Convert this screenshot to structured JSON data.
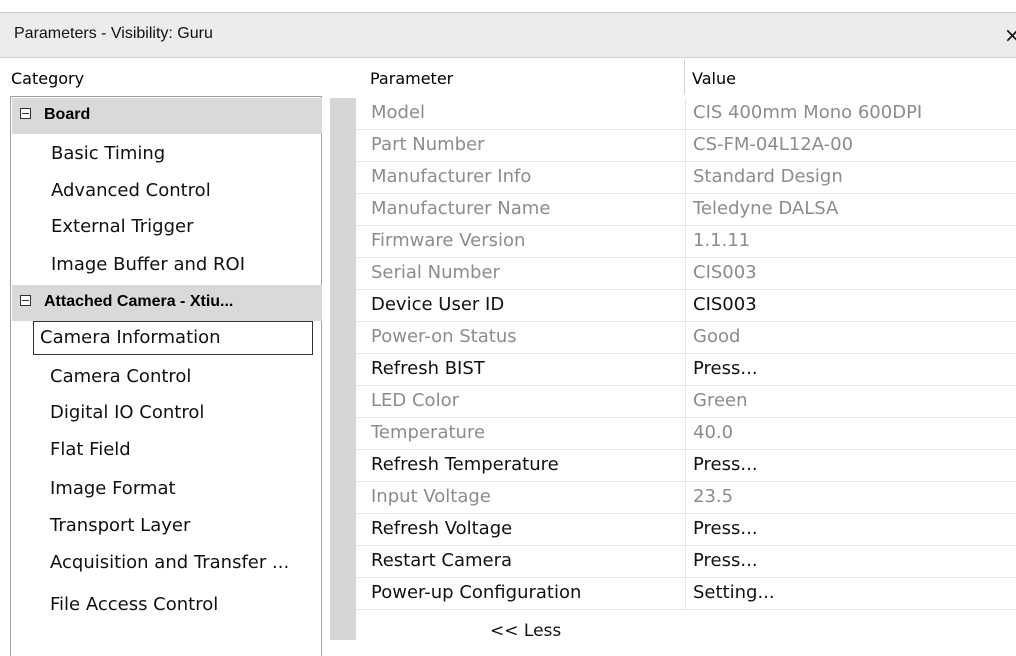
{
  "window": {
    "title": "Parameters - Visibility: Guru",
    "close_label": "×"
  },
  "headers": {
    "category": "Category",
    "parameter": "Parameter",
    "value": "Value"
  },
  "categories": {
    "groups": [
      {
        "label": "Board",
        "expanded": true
      },
      {
        "label": "Attached Camera - Xtiu...",
        "expanded": true
      }
    ],
    "board_items": [
      "Basic Timing",
      "Advanced Control",
      "External Trigger",
      "Image Buffer and ROI"
    ],
    "camera_items": [
      "Camera Information",
      "Camera Control",
      "Digital IO Control",
      "Flat Field",
      "Image Format",
      "Transport Layer",
      "Acquisition and Transfer ...",
      "File Access Control"
    ],
    "selected": "Camera Information"
  },
  "parameters": [
    {
      "name": "Model",
      "value": "CIS 400mm Mono 600DPI",
      "enabled": false
    },
    {
      "name": "Part Number",
      "value": "CS-FM-04L12A-00",
      "enabled": false
    },
    {
      "name": "Manufacturer Info",
      "value": "Standard Design",
      "enabled": false
    },
    {
      "name": "Manufacturer Name",
      "value": "Teledyne DALSA",
      "enabled": false
    },
    {
      "name": "Firmware Version",
      "value": "1.1.11",
      "enabled": false
    },
    {
      "name": "Serial Number",
      "value": "CIS003",
      "enabled": false
    },
    {
      "name": "Device User ID",
      "value": "CIS003",
      "enabled": true
    },
    {
      "name": "Power-on Status",
      "value": "Good",
      "enabled": false
    },
    {
      "name": "Refresh BIST",
      "value": "Press...",
      "enabled": true
    },
    {
      "name": "LED Color",
      "value": "Green",
      "enabled": false
    },
    {
      "name": "Temperature",
      "value": "40.0",
      "enabled": false
    },
    {
      "name": "Refresh Temperature",
      "value": "Press...",
      "enabled": true
    },
    {
      "name": "Input Voltage",
      "value": "23.5",
      "enabled": false
    },
    {
      "name": "Refresh Voltage",
      "value": "Press...",
      "enabled": true
    },
    {
      "name": "Restart Camera",
      "value": "Press...",
      "enabled": true
    },
    {
      "name": "Power-up Configuration",
      "value": "Setting...",
      "enabled": true
    }
  ],
  "less_label": "<< Less"
}
